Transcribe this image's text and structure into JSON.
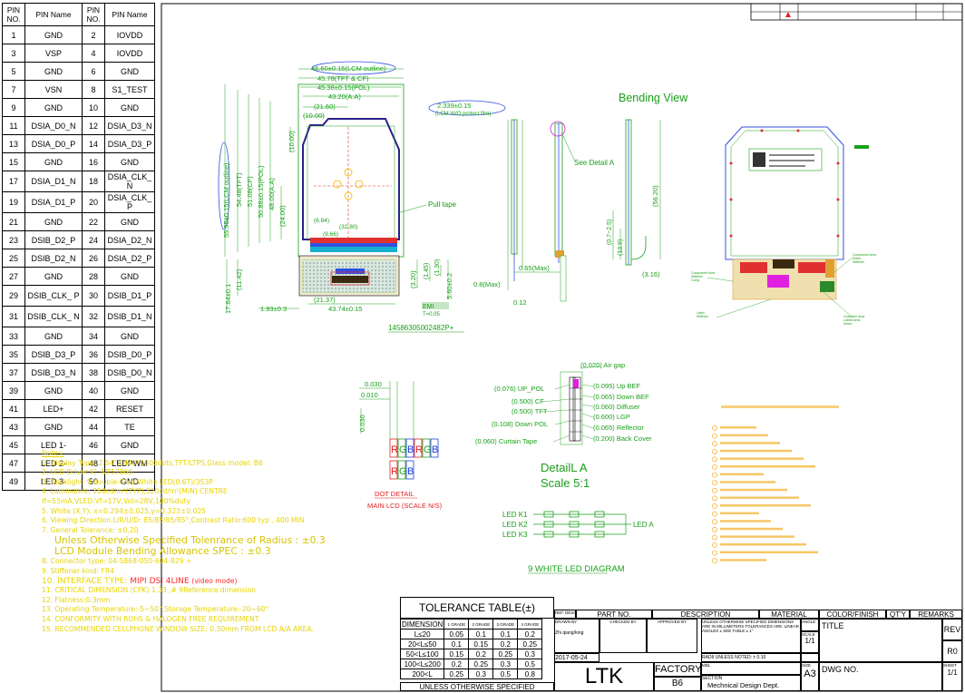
{
  "pin_table": {
    "headers": [
      "PIN NO.",
      "PIN Name",
      "PIN NO.",
      "PIN Name"
    ],
    "rows": [
      [
        "1",
        "GND",
        "2",
        "IOVDD"
      ],
      [
        "3",
        "VSP",
        "4",
        "IOVDD"
      ],
      [
        "5",
        "GND",
        "6",
        "GND"
      ],
      [
        "7",
        "VSN",
        "8",
        "S1_TEST"
      ],
      [
        "9",
        "GND",
        "10",
        "GND"
      ],
      [
        "11",
        "DSIA_D0_N",
        "12",
        "DSIA_D3_N"
      ],
      [
        "13",
        "DSIA_D0_P",
        "14",
        "DSIA_D3_P"
      ],
      [
        "15",
        "GND",
        "16",
        "GND"
      ],
      [
        "17",
        "DSIA_D1_N",
        "18",
        "DSIA_CLK_ N"
      ],
      [
        "19",
        "DSIA_D1_P",
        "20",
        "DSIA_CLK_ P"
      ],
      [
        "21",
        "GND",
        "22",
        "GND"
      ],
      [
        "23",
        "DSIB_D2_P",
        "24",
        "DSIA_D2_N"
      ],
      [
        "25",
        "DSIB_D2_N",
        "26",
        "DSIA_D2_P"
      ],
      [
        "27",
        "GND",
        "28",
        "GND"
      ],
      [
        "29",
        "DSIB_CLK_ P",
        "30",
        "DSIB_D1_P"
      ],
      [
        "31",
        "DSIB_CLK_ N",
        "32",
        "DSIB_D1_N"
      ],
      [
        "33",
        "GND",
        "34",
        "GND"
      ],
      [
        "35",
        "DSIB_D3_P",
        "36",
        "DSIB_D0_P"
      ],
      [
        "37",
        "DSIB_D3_N",
        "38",
        "DSIB_D0_N"
      ],
      [
        "39",
        "GND",
        "40",
        "GND"
      ],
      [
        "41",
        "LED+",
        "42",
        "RESET"
      ],
      [
        "43",
        "GND",
        "44",
        "TE"
      ],
      [
        "45",
        "LED 1-",
        "46",
        "GND"
      ],
      [
        "47",
        "LED 2-",
        "48",
        "LEDPWM"
      ],
      [
        "49",
        "LED 3-",
        "50",
        "GND"
      ]
    ]
  },
  "notes": {
    "title": "Notes:",
    "items": [
      "1. Display Type: 2.54\",1440*1600dots,TFT/LTPS,Glass model: B6",
      "2. LCD Driver IC: NT57860",
      "3. Backlight: 9 double-Chip White LED(0.6T)/3S3P",
      "4. Luminance: 350cd/m²(TYP),320cd/m²(MIN) CENTRE",
      "   If=55mA,VLED:Vf=17V,Vol=28V,100%duty",
      "5. White (X,Y): x=0.294±0.025,y=0.323±0.025",
      "6. Viewing Direction L/R/U/D: 85/85/85/85°,Contrast Ratio:600 typ , 400 MIN",
      "7. General Tolerance: ±0.20"
    ],
    "radius_line_1": "Unless Otherwise Specified Tolenrance of Radius : ±0.3",
    "radius_line_2": "LCD Module Bending Allowance SPEC : ±0.3",
    "items2": [
      "8. Connector type: 04-5868-050-604-829 +",
      "9. Stiffener kind: FR4"
    ],
    "interface_prefix": "10. INTERFACE TYPE:",
    "interface_value": "MIPI DSI 4LINE",
    "interface_suffix": "(video mode)",
    "items3": [
      "11. CRITICAL DIMENSION (CPK) 1.33 ,# 9Reference dimension",
      "12. Flatness:0.3mm",
      "13. Operating Temperature:-5~50°,Storage Temperature:-20~60°",
      "14. CONFORMITY WITH ROHS & HALOGEN FREE REQUIREMENT",
      "15. RECOMMENDED CELLPHONE WINDOW SIZE: 0.30mm FROM LCD A/A AREA."
    ]
  },
  "front_view": {
    "dims_top": [
      "46.60±0.15(LCM outline)",
      "45.78(TFT & CF)",
      "45.38±0.15(POL)",
      "43.20(A.A)",
      "(21.60)",
      "(10.00)"
    ],
    "dims_left": [
      "55.55±0.15(LCM outline)",
      "54.48(TFT)",
      "51.08(CF)",
      "50.88±0.15(POL)",
      "48.00(A.A)",
      "(24.00)",
      "(10.00)"
    ],
    "dims_bottom": [
      "(6.84)",
      "(32.80)",
      "(9.66)",
      "(21.37)",
      "43.74±0.15",
      "1.93±0.3",
      "17.64±0.1",
      "(11.42)"
    ],
    "dims_right": [
      "(3.20)",
      "(1.45)",
      "(1.30)",
      "5.60±0.2"
    ],
    "pull_tape": "Pull tape",
    "emi": "EMI",
    "emi_t": "T=0.05",
    "part_number": "14586305002482P+"
  },
  "side_view": {
    "protect_film": "2.339±0.15",
    "protect_film_sub": "(LCM W/O protect film)",
    "see_detail": "See Detail A",
    "dims": [
      "0.65(Max)",
      "0.8(Max)",
      "0.12"
    ]
  },
  "bending_view": {
    "title": "Bending View",
    "dims": [
      "(56.20)",
      "(0.7~2.5)",
      "(13.9)",
      "(3.16)"
    ]
  },
  "detail_a": {
    "title": "DetailL A",
    "scale": "Scale 5:1",
    "layers_left": [
      "(0.076) UP_POL",
      "(0.500) CF",
      "(0.500) TFT",
      "(0.108) Down POL",
      "(0.060) Curtain Tape"
    ],
    "layers_right": [
      "(0.020) Air gap",
      "(0.095) Up BEF",
      "(0.065) Down BEF",
      "(0.060) Diffuser",
      "(0.600) LGP",
      "(0.065) Reflector",
      "(0.200) Back Cover"
    ]
  },
  "dot_detail": {
    "dims": [
      "0.030",
      "0.010",
      "0.030"
    ],
    "sub_pixels": [
      "R",
      "G",
      "B",
      "R",
      "G",
      "B"
    ],
    "title": "DOT DETAIL",
    "subtitle": "MAIN LCD (SCALE N/S)"
  },
  "led_diagram": {
    "inputs": [
      "LED K1",
      "LED K2",
      "LED K3"
    ],
    "output": "LED A",
    "title": "9 WHITE LED DIAGRAM"
  },
  "title_block": {
    "tolerance_title": "TOLERANCE TABLE(±)",
    "tol_header": [
      "DIMENSION",
      "1 GRADE",
      "2 GRADE",
      "3 GRADE",
      "4 GRADE"
    ],
    "tol_rows": [
      [
        "L≤20",
        "0.05",
        "0.1",
        "0.1",
        "0.2"
      ],
      [
        "20<L≤50",
        "0.1",
        "0.15",
        "0.2",
        "0.25"
      ],
      [
        "50<L≤100",
        "0.15",
        "0.2",
        "0.25",
        "0.3"
      ],
      [
        "100<L≤200",
        "0.2",
        "0.25",
        "0.3",
        "0.5"
      ],
      [
        "200<L",
        "0.25",
        "0.3",
        "0.5",
        "0.8"
      ]
    ],
    "unless": "UNLESS OTHERWISE SPECIFIED",
    "ref_desc": "REF. DESC.",
    "part_no": "PART NO.",
    "description": "DESCRIPTION",
    "material": "MATERIAL",
    "color_finish": "COLOR/FINISH",
    "qty": "QT'Y",
    "remarks": "REMARKS",
    "drawn_by": "DRAWN BY",
    "checked_by": "CHECKED BY",
    "approved_by": "APPROVED BY",
    "drawer": "Zhi qiang/long",
    "date": "2017-05-24",
    "company": "LTK",
    "factory": "FACTORY",
    "factory_value": "B6",
    "section": "SECTION",
    "dept": "Mechnical Design Dept.",
    "spec_note": "UNLESS OTHERWISE SPECIFIED DIMENSIONS ARE IN MILLIMETERS TOLERANCES ARE: LINEAR ANGLES ± SEE TABLE ± 1°",
    "radii": "RADII UNLESS NOTED: ± 0.10",
    "angle_label": "ANGLE",
    "scale_label": "SCALE",
    "scale_value": "1/1",
    "mdl": "MDL",
    "size_label": "SIZE",
    "size_value": "A3",
    "title_label": "TITLE",
    "dwg_no": "DWG NO.",
    "rev": "REV",
    "rev_value": "R0",
    "sheet": "SHEET",
    "sheet_value": "1/1"
  }
}
